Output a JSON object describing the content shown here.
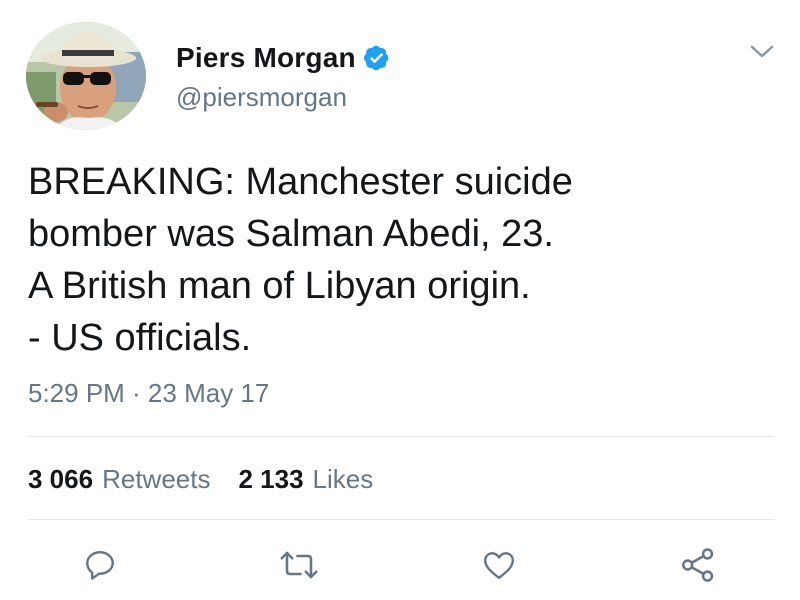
{
  "author": {
    "name": "Piers Morgan",
    "handle": "@piersmorgan",
    "verified": true
  },
  "tweet": {
    "lines": [
      "BREAKING: Manchester suicide",
      "bomber was Salman Abedi, 23.",
      "A British man of Libyan origin.",
      "- US officials."
    ],
    "timestamp": "5:29 PM · 23 May 17"
  },
  "stats": {
    "retweets_count": "3 066",
    "retweets_label": "Retweets",
    "likes_count": "2 133",
    "likes_label": "Likes"
  },
  "actions": [
    {
      "name": "reply",
      "icon": "reply-icon"
    },
    {
      "name": "retweet",
      "icon": "retweet-icon"
    },
    {
      "name": "like",
      "icon": "heart-icon"
    },
    {
      "name": "share",
      "icon": "share-icon"
    }
  ],
  "colors": {
    "text": "#14171a",
    "secondary": "#657786",
    "verified": "#1da1f2",
    "icon": "#657786",
    "divider": "#e1e8ed"
  }
}
